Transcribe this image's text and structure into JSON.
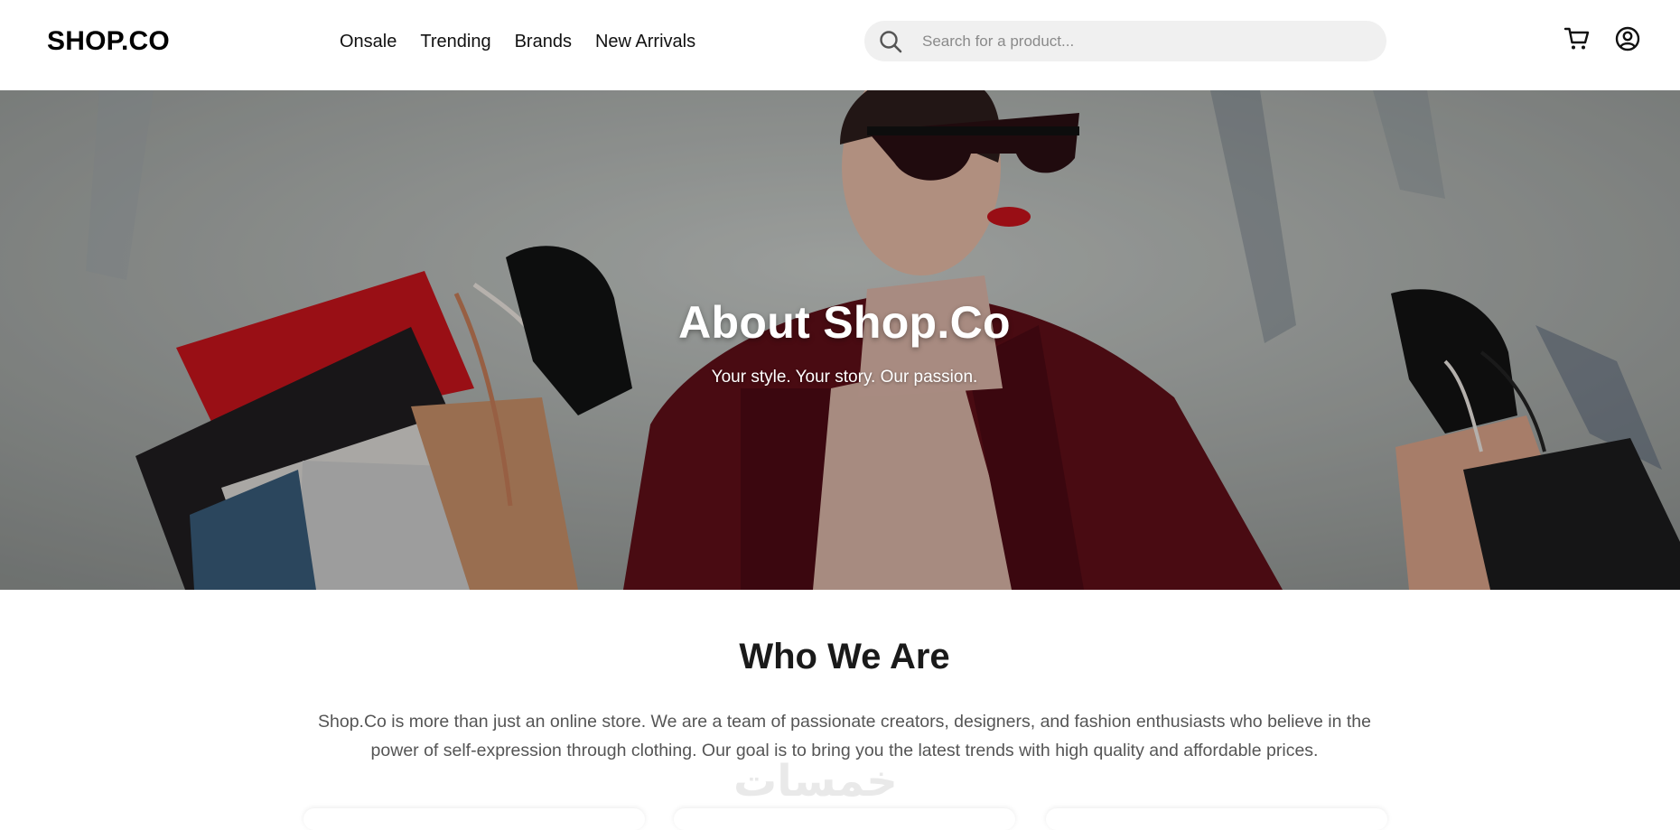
{
  "header": {
    "logo": "SHOP.CO",
    "nav": [
      "Onsale",
      "Trending",
      "Brands",
      "New Arrivals"
    ],
    "search": {
      "placeholder": "Search for a product...",
      "value": "",
      "icon": "search-icon"
    },
    "icons": [
      "cart-icon",
      "user-icon"
    ]
  },
  "hero": {
    "title": "About Shop.Co",
    "subtitle": "Your style. Your story. Our passion."
  },
  "who": {
    "title": "Who We Are",
    "text": "Shop.Co is more than just an online store. We are a team of passionate creators, designers, and fashion enthusiasts who believe in the power of self-expression through clothing. Our goal is to bring you the latest trends with high quality and affordable prices.",
    "watermark": "خمسات"
  },
  "colors": {
    "text": "#111111",
    "search_bg": "#f0f0f0",
    "coat": "#5e0f18",
    "lips": "#c4121c"
  }
}
